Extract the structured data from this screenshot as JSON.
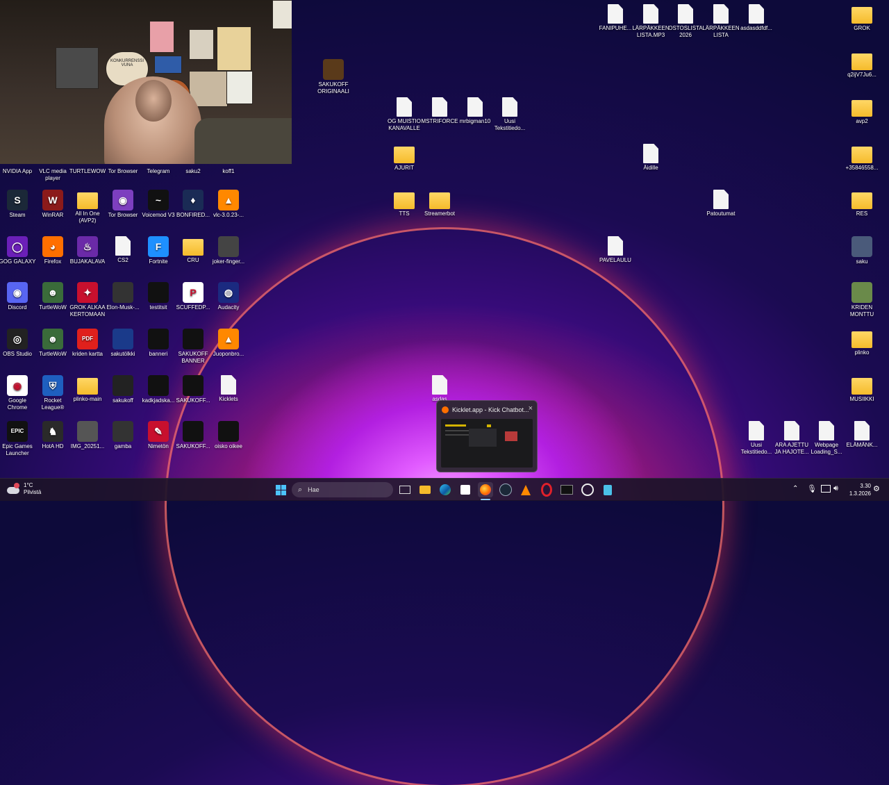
{
  "webcam": {
    "poster_text": "KONKURRENSSI VUNA"
  },
  "desktop_left": [
    {
      "key": "nvidia",
      "label": "NVIDIA App",
      "color": "#76b900",
      "glyph": ""
    },
    {
      "key": "vlc1",
      "label": "VLC media player",
      "color": "#ff8800",
      "glyph": ""
    },
    {
      "key": "turtlewow1",
      "label": "TURTLEWOW",
      "color": "#3a5b3a",
      "glyph": ""
    },
    {
      "key": "tor1",
      "label": "Tor Browser",
      "color": "#7d3fbf",
      "glyph": ""
    },
    {
      "key": "telegram",
      "label": "Telegram",
      "color": "#2aa1da",
      "glyph": ""
    },
    {
      "key": "saku2",
      "label": "saku2",
      "color": "#555",
      "glyph": ""
    },
    {
      "key": "koff1",
      "label": "koff1",
      "color": "#555",
      "glyph": ""
    },
    {
      "key": "steam",
      "label": "Steam",
      "color": "#1b2838",
      "glyph": "S"
    },
    {
      "key": "winrar",
      "label": "WinRAR",
      "color": "#8b1a1a",
      "glyph": "W"
    },
    {
      "key": "allinone",
      "label": "All In One (AVP2)",
      "color": "folder",
      "glyph": ""
    },
    {
      "key": "tor2",
      "label": "Tor Browser",
      "color": "#7d3fbf",
      "glyph": "◉"
    },
    {
      "key": "voicemod",
      "label": "Voicemod V3",
      "color": "#111",
      "glyph": "~"
    },
    {
      "key": "bonfired",
      "label": "BONFIRED...",
      "color": "#1a2b55",
      "glyph": "♦"
    },
    {
      "key": "vlc2",
      "label": "vlc-3.0.23-...",
      "color": "#ff8800",
      "glyph": "▲"
    },
    {
      "key": "gog",
      "label": "GOG GALAXY",
      "color": "#6b1fb8",
      "glyph": "◯"
    },
    {
      "key": "firefox",
      "label": "Firefox",
      "color": "#ff6f00",
      "glyph": "◕"
    },
    {
      "key": "bujakalava",
      "label": "BUJAKALAVA",
      "color": "#6b2aa8",
      "glyph": "♨"
    },
    {
      "key": "cs2",
      "label": "CS2",
      "color": "doc",
      "glyph": ""
    },
    {
      "key": "fortnite",
      "label": "Fortnite",
      "color": "#1e90ff",
      "glyph": "F"
    },
    {
      "key": "cru",
      "label": "CRU",
      "color": "folder",
      "glyph": ""
    },
    {
      "key": "joker",
      "label": "joker-finger...",
      "color": "#444",
      "glyph": ""
    },
    {
      "key": "discord",
      "label": "Discord",
      "color": "#5865f2",
      "glyph": "◉"
    },
    {
      "key": "turtlewow2",
      "label": "TurtleWoW",
      "color": "#3a6b3a",
      "glyph": "☻"
    },
    {
      "key": "grok_alkaa",
      "label": "GROK ALKAA KERTOMAAN",
      "color": "#c8102e",
      "glyph": "✦"
    },
    {
      "key": "elon",
      "label": "Elon-Musk-...",
      "color": "#333",
      "glyph": ""
    },
    {
      "key": "testitsit",
      "label": "testitsit",
      "color": "#111",
      "glyph": ""
    },
    {
      "key": "scuffed",
      "label": "SCUFFEDP...",
      "color": "#ffffff",
      "glyph": "P"
    },
    {
      "key": "audacity",
      "label": "Audacity",
      "color": "#1b2a80",
      "glyph": "◍"
    },
    {
      "key": "obs",
      "label": "OBS Studio",
      "color": "#222",
      "glyph": "◎"
    },
    {
      "key": "turtlewow3",
      "label": "TurtleWoW",
      "color": "#3a6b3a",
      "glyph": "☻"
    },
    {
      "key": "kriden_kartta",
      "label": "kriden kartta",
      "color": "#e0201c",
      "glyph": "PDF"
    },
    {
      "key": "sakutolkki",
      "label": "sakutölkki",
      "color": "#1a3a8a",
      "glyph": ""
    },
    {
      "key": "banneri",
      "label": "banneri",
      "color": "#111",
      "glyph": ""
    },
    {
      "key": "sakukoff_banner",
      "label": "SAKUKOFF BANNER",
      "color": "#111",
      "glyph": ""
    },
    {
      "key": "juoponbro",
      "label": "Juoponbro...",
      "color": "#ff8800",
      "glyph": "▲"
    },
    {
      "key": "chrome",
      "label": "Google Chrome",
      "color": "#ffffff",
      "glyph": "◉"
    },
    {
      "key": "rocket",
      "label": "Rocket League®",
      "color": "#1e5fbf",
      "glyph": "⛨"
    },
    {
      "key": "plinko_main",
      "label": "plinko-main",
      "color": "folder",
      "glyph": ""
    },
    {
      "key": "sakukoff1",
      "label": "sakukoff",
      "color": "#222",
      "glyph": ""
    },
    {
      "key": "kadkjad",
      "label": "kadkjadska...",
      "color": "#111",
      "glyph": ""
    },
    {
      "key": "sakukoff2",
      "label": "SAKUKOFF...",
      "color": "#111",
      "glyph": ""
    },
    {
      "key": "kicklets",
      "label": "Kicklets",
      "color": "doc",
      "glyph": ""
    },
    {
      "key": "epic",
      "label": "Epic Games Launcher",
      "color": "#111",
      "glyph": "EPIC"
    },
    {
      "key": "hota",
      "label": "HotA HD",
      "color": "#2a2a2a",
      "glyph": "♞"
    },
    {
      "key": "img2025",
      "label": "IMG_20251...",
      "color": "#555",
      "glyph": ""
    },
    {
      "key": "gamba",
      "label": "gamba",
      "color": "#333",
      "glyph": ""
    },
    {
      "key": "nimeton",
      "label": "Nimetön",
      "color": "#c8102e",
      "glyph": "✎"
    },
    {
      "key": "sakukoff3",
      "label": "SAKUKOFF...",
      "color": "#111",
      "glyph": ""
    },
    {
      "key": "oisko",
      "label": "oisko oikee",
      "color": "#111",
      "glyph": ""
    }
  ],
  "desktop_middle": [
    {
      "key": "originaali",
      "label": "SAKUKOFF ORIGINAALI",
      "color": "#5a3a1a",
      "glyph": ""
    },
    {
      "key": "og_muistio",
      "label": "OG MUISTIO KANAVALLE",
      "color": "doc",
      "glyph": ""
    },
    {
      "key": "mstriforce",
      "label": "MSTRIFORCE",
      "color": "doc",
      "glyph": ""
    },
    {
      "key": "mrbigman",
      "label": "mrbigman10",
      "color": "doc",
      "glyph": ""
    },
    {
      "key": "uusi_teksti_top",
      "label": "Uusi Tekstitiedo...",
      "color": "doc",
      "glyph": ""
    },
    {
      "key": "ajurit",
      "label": "AJURIT",
      "color": "folder",
      "glyph": ""
    },
    {
      "key": "tts",
      "label": "TTS",
      "color": "folder",
      "glyph": ""
    },
    {
      "key": "streamerbot",
      "label": "Streamerbot",
      "color": "folder",
      "glyph": ""
    },
    {
      "key": "asdas",
      "label": "asdas",
      "color": "doc",
      "glyph": ""
    },
    {
      "key": "aidille",
      "label": "Äidille",
      "color": "doc",
      "glyph": ""
    },
    {
      "key": "patoutumat",
      "label": "Patoutumat",
      "color": "doc",
      "glyph": ""
    },
    {
      "key": "pavelaulu",
      "label": "PAVELAULU",
      "color": "doc",
      "glyph": ""
    }
  ],
  "desktop_top_right": [
    {
      "key": "fanipuhe",
      "label": "FANIPUHE...",
      "color": "doc",
      "glyph": ""
    },
    {
      "key": "larpakkeen_mp3",
      "label": "LÄRPÄKKEEN LISTA.MP3",
      "color": "doc",
      "glyph": ""
    },
    {
      "key": "ostoslista",
      "label": "OSTOSLISTA 2026",
      "color": "doc",
      "glyph": ""
    },
    {
      "key": "larpakkeen_lista",
      "label": "LÄRPÄKKEEN LISTA",
      "color": "doc",
      "glyph": ""
    },
    {
      "key": "asdasddfdf",
      "label": "asdasddfdf...",
      "color": "doc",
      "glyph": ""
    }
  ],
  "desktop_right_col": [
    {
      "key": "grok",
      "label": "GROK",
      "color": "folder",
      "glyph": ""
    },
    {
      "key": "q2ijv",
      "label": "q2ijV7Ju6...",
      "color": "folder",
      "glyph": ""
    },
    {
      "key": "avp2",
      "label": "avp2",
      "color": "folder",
      "glyph": ""
    },
    {
      "key": "phone",
      "label": "+35846558...",
      "color": "folder",
      "glyph": ""
    },
    {
      "key": "res",
      "label": "RES",
      "color": "folder",
      "glyph": ""
    },
    {
      "key": "saku",
      "label": "saku",
      "color": "#4a5a7a",
      "glyph": ""
    },
    {
      "key": "kriden_monttu",
      "label": "KRIDEN MONTTU",
      "color": "#6a8a4a",
      "glyph": ""
    },
    {
      "key": "plinko",
      "label": "plinko",
      "color": "folder",
      "glyph": ""
    },
    {
      "key": "musiikki",
      "label": "MUSIIKKI",
      "color": "folder",
      "glyph": ""
    }
  ],
  "desktop_bottom_right": [
    {
      "key": "uusi_teksti_bottom",
      "label": "Uusi Tekstitiedo...",
      "color": "doc",
      "glyph": ""
    },
    {
      "key": "ara_ajettu",
      "label": "ARA AJETTU JA HAJOTE...",
      "color": "doc",
      "glyph": ""
    },
    {
      "key": "webpage_loading",
      "label": "Webpage Loading_S...",
      "color": "doc",
      "glyph": ""
    },
    {
      "key": "elamanke",
      "label": "ELÄMÄNK...",
      "color": "doc",
      "glyph": ""
    }
  ],
  "thumbnail": {
    "title": "Kicklet.app - Kick Chatbot...",
    "close": "×"
  },
  "taskbar": {
    "weather_temp": "1°C",
    "weather_desc": "Pilvistä",
    "search_placeholder": "Hae",
    "time": "3.30",
    "date": "1.3.2026"
  }
}
